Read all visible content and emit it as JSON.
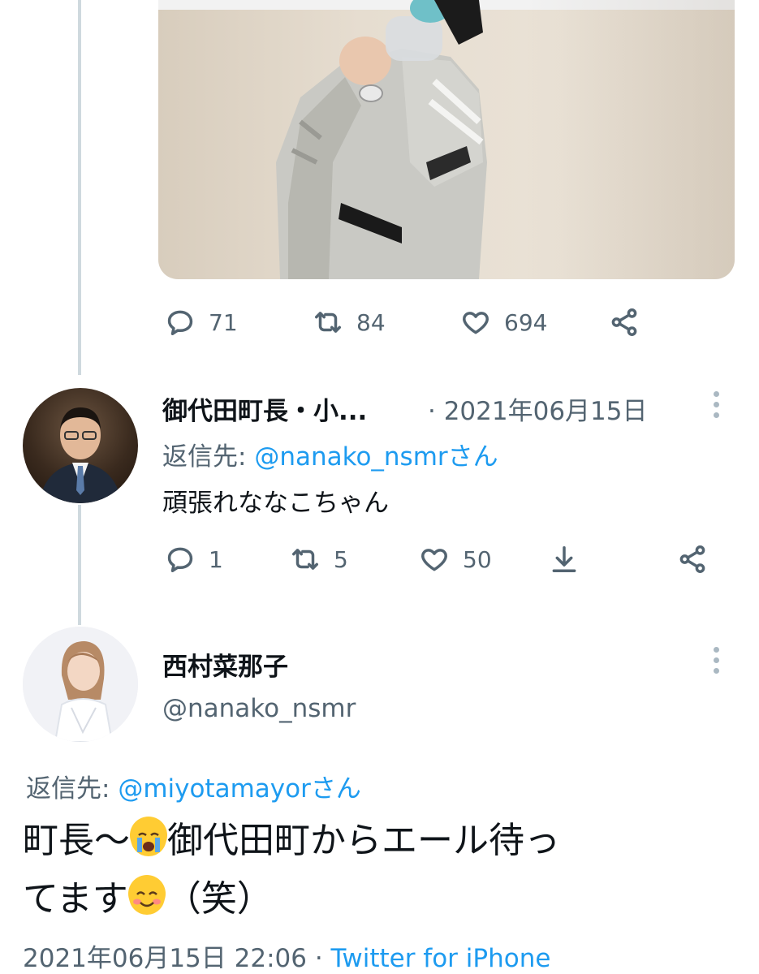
{
  "tweet1": {
    "actions": {
      "replies": "71",
      "retweets": "84",
      "likes": "694"
    }
  },
  "reply1": {
    "author_name": "御代田町長・小...",
    "date": "· 2021年06月15日",
    "reply_to_prefix": "返信先: ",
    "reply_to_handle": "@nanako_nsmrさん",
    "text": "頑張れななこちゃん",
    "actions": {
      "replies": "1",
      "retweets": "5",
      "likes": "50"
    }
  },
  "main_tweet": {
    "author_name": "西村菜那子",
    "author_handle": "@nanako_nsmr",
    "reply_to_prefix": "返信先: ",
    "reply_to_handle": "@miyotamayorさん",
    "text_part1": "町長〜",
    "text_part2": "御代田町からエール待っ",
    "text_part3": "てます",
    "text_part4": "（笑）",
    "timestamp": "2021年06月15日 22:06 · ",
    "source": "Twitter for iPhone"
  },
  "icons": {
    "reply": "reply-bubble-icon",
    "retweet": "retweet-icon",
    "like": "heart-icon",
    "share": "share-icon",
    "download": "download-icon",
    "more": "kebab-icon"
  },
  "colors": {
    "link": "#1d9bf0",
    "muted": "#536471",
    "text": "#0f1419",
    "thread": "#cfd9de"
  }
}
